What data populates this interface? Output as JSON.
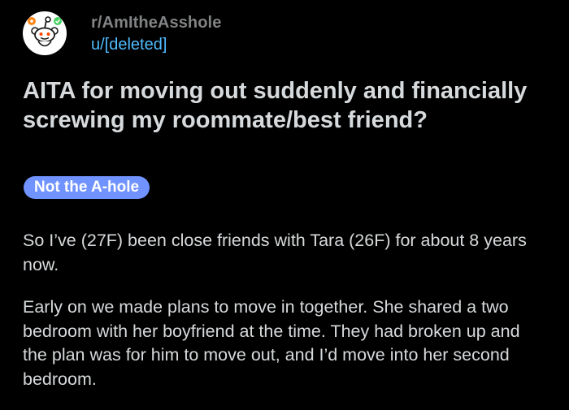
{
  "post": {
    "subreddit": "r/AmItheAsshole",
    "author": "u/[deleted]",
    "title": "AITA for moving out suddenly and financially screwing my roommate/best friend?",
    "flair": "Not the A-hole",
    "paragraphs": [
      "So I’ve (27F) been close friends with Tara (26F) for about 8 years now.",
      "Early on we made plans to move in together. She shared a two bedroom with her boyfriend at the time. They had broken up and the plan was for him to move out, and I’d move into her second bedroom."
    ]
  },
  "icons": {
    "avatar": "snoo-avatar-icon"
  },
  "colors": {
    "background": "#000000",
    "text": "#d7dadc",
    "muted": "#818384",
    "link": "#4fbcff",
    "flair_bg": "#7193ff",
    "flair_text": "#ffffff"
  }
}
